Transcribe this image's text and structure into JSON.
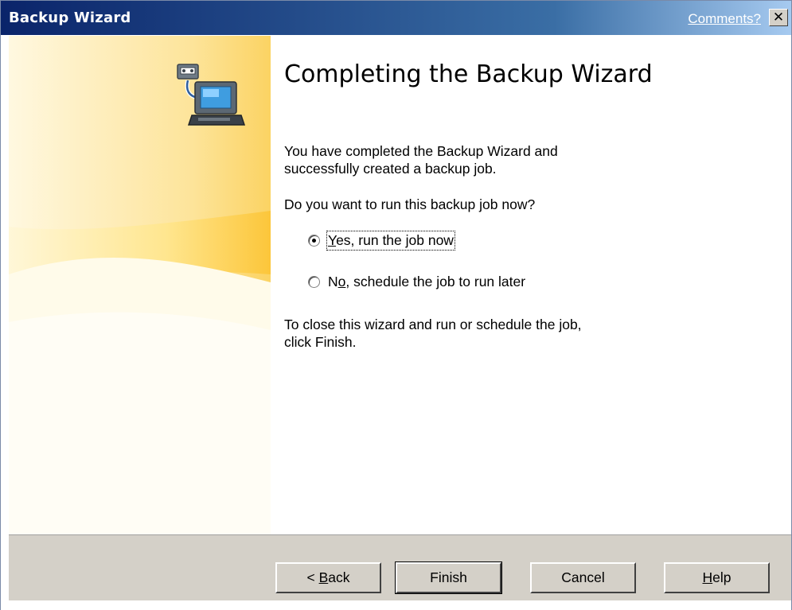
{
  "window": {
    "title": "Backup Wizard",
    "comments_link": "Comments?",
    "close_label": "✕"
  },
  "main": {
    "heading": "Completing the Backup Wizard",
    "completed_text_line1": "You have completed the Backup Wizard and",
    "completed_text_line2": "successfully created a backup job.",
    "question": "Do you want to run this backup job now?",
    "options": [
      {
        "prefix": "",
        "mnemonic": "Y",
        "rest": "es, run the job now",
        "checked": true
      },
      {
        "prefix": "N",
        "mnemonic": "o",
        "rest": ", schedule the job to run later",
        "checked": false
      }
    ],
    "close_text_line1": "To close this wizard and run or schedule the job,",
    "close_text_line2": "click Finish."
  },
  "buttons": {
    "back_prefix": "< ",
    "back_mnemonic": "B",
    "back_rest": "ack",
    "finish": "Finish",
    "cancel": "Cancel",
    "help_mnemonic": "H",
    "help_rest": "elp"
  },
  "icons": {
    "wizard_graphic": "backup-computer-icon"
  },
  "colors": {
    "title_bar_start": "#0a246a",
    "title_bar_end": "#a6caf0",
    "button_face": "#d4d0c8",
    "side_panel_accent": "#fcc63a"
  }
}
